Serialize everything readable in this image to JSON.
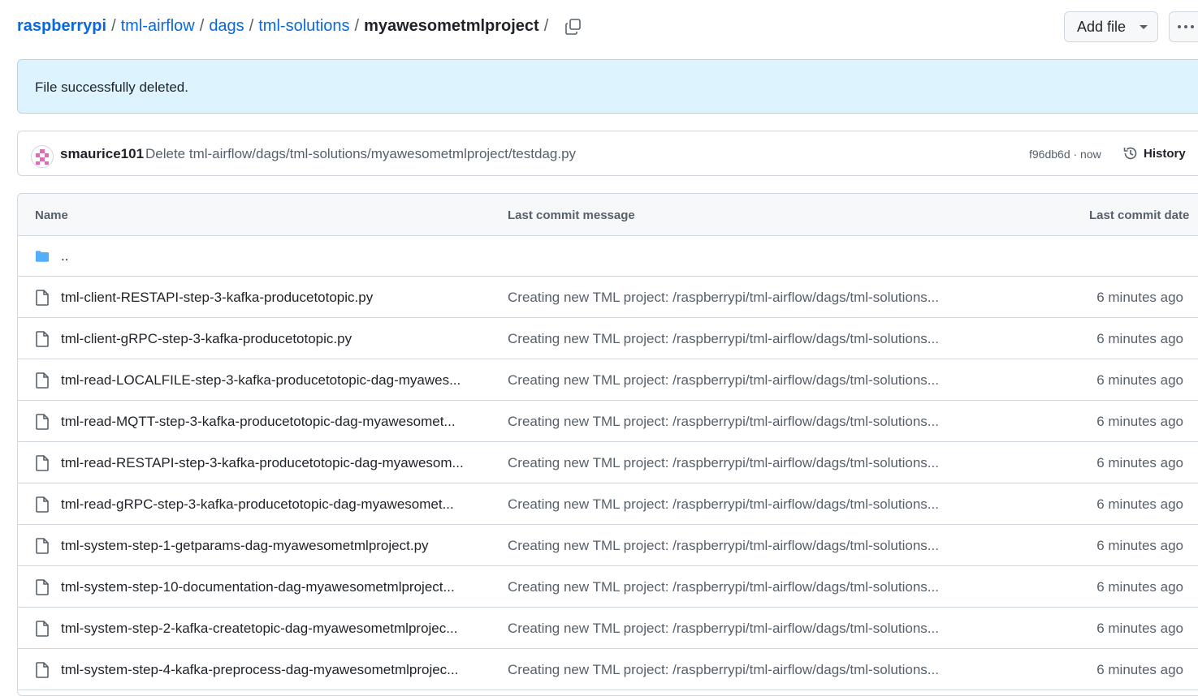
{
  "breadcrumb": {
    "owner": "raspberrypi",
    "parts": [
      "tml-airflow",
      "dags",
      "tml-solutions"
    ],
    "current": "myawesometmlproject",
    "separator": "/"
  },
  "toolbar": {
    "add_file_label": "Add file"
  },
  "flash": {
    "message": "File successfully deleted."
  },
  "commit": {
    "author": "smaurice101",
    "message": "Delete tml-airflow/dags/tml-solutions/myawesometmlproject/testdag.py",
    "meta": "f96db6d · now",
    "history_label": "History"
  },
  "table": {
    "headers": {
      "name": "Name",
      "message": "Last commit message",
      "date": "Last commit date"
    },
    "parent_dir": "..",
    "rows": [
      {
        "name": "tml-client-RESTAPI-step-3-kafka-producetotopic.py",
        "message": "Creating new TML project: /raspberrypi/tml-airflow/dags/tml-solutions...",
        "date": "6 minutes ago"
      },
      {
        "name": "tml-client-gRPC-step-3-kafka-producetotopic.py",
        "message": "Creating new TML project: /raspberrypi/tml-airflow/dags/tml-solutions...",
        "date": "6 minutes ago"
      },
      {
        "name": "tml-read-LOCALFILE-step-3-kafka-producetotopic-dag-myawes...",
        "message": "Creating new TML project: /raspberrypi/tml-airflow/dags/tml-solutions...",
        "date": "6 minutes ago"
      },
      {
        "name": "tml-read-MQTT-step-3-kafka-producetotopic-dag-myawesomet...",
        "message": "Creating new TML project: /raspberrypi/tml-airflow/dags/tml-solutions...",
        "date": "6 minutes ago"
      },
      {
        "name": "tml-read-RESTAPI-step-3-kafka-producetotopic-dag-myawesom...",
        "message": "Creating new TML project: /raspberrypi/tml-airflow/dags/tml-solutions...",
        "date": "6 minutes ago"
      },
      {
        "name": "tml-read-gRPC-step-3-kafka-producetotopic-dag-myawesomet...",
        "message": "Creating new TML project: /raspberrypi/tml-airflow/dags/tml-solutions...",
        "date": "6 minutes ago"
      },
      {
        "name": "tml-system-step-1-getparams-dag-myawesometmlproject.py",
        "message": "Creating new TML project: /raspberrypi/tml-airflow/dags/tml-solutions...",
        "date": "6 minutes ago"
      },
      {
        "name": "tml-system-step-10-documentation-dag-myawesometmlproject...",
        "message": "Creating new TML project: /raspberrypi/tml-airflow/dags/tml-solutions...",
        "date": "6 minutes ago"
      },
      {
        "name": "tml-system-step-2-kafka-createtopic-dag-myawesometmlprojec...",
        "message": "Creating new TML project: /raspberrypi/tml-airflow/dags/tml-solutions...",
        "date": "6 minutes ago"
      },
      {
        "name": "tml-system-step-4-kafka-preprocess-dag-myawesometmlprojec...",
        "message": "Creating new TML project: /raspberrypi/tml-airflow/dags/tml-solutions...",
        "date": "6 minutes ago"
      }
    ]
  },
  "colors": {
    "link": "#0969da",
    "flash_bg": "#ddf4ff",
    "folder": "#54aeff",
    "border": "#d0d7de"
  },
  "icons": {
    "copy": "copy-icon",
    "folder": "folder-icon",
    "file": "file-icon",
    "history": "history-icon"
  }
}
